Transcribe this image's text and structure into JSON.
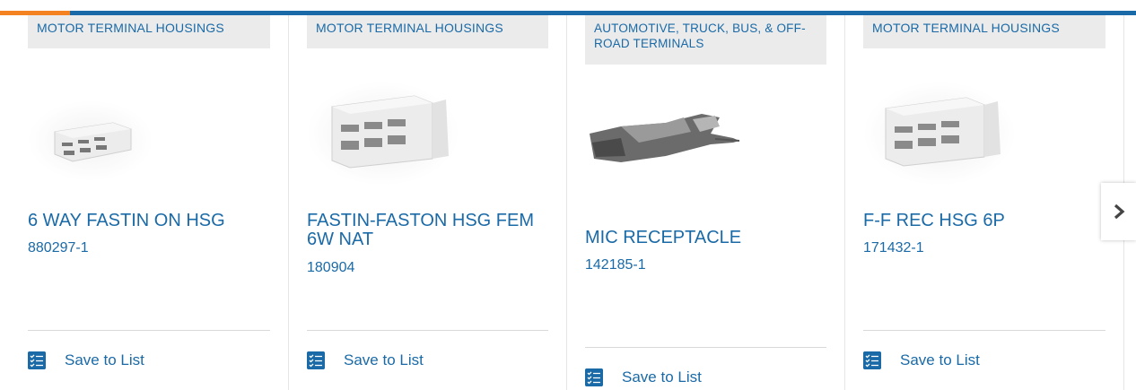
{
  "colors": {
    "brand_blue": "#1a6aa7",
    "accent_orange": "#f58220",
    "category_bg": "#ebebeb"
  },
  "carousel": {
    "next_icon": "chevron-right-icon",
    "cards": [
      {
        "category": "MOTOR TERMINAL HOUSINGS",
        "title": "6 WAY FASTIN ON HSG",
        "part_number": "880297-1",
        "image": "connector-housing-6way-image",
        "save_label": "Save to List"
      },
      {
        "category": "MOTOR TERMINAL HOUSINGS",
        "title": "FASTIN-FASTON HSG FEM 6W NAT",
        "part_number": "180904",
        "image": "connector-housing-fem-image",
        "save_label": "Save to List"
      },
      {
        "category": "AUTOMOTIVE, TRUCK, BUS, & OFF-ROAD TERMINALS",
        "title": "MIC RECEPTACLE",
        "part_number": "142185-1",
        "image": "metal-receptacle-terminal-image",
        "save_label": "Save to List"
      },
      {
        "category": "MOTOR TERMINAL HOUSINGS",
        "title": "F-F REC HSG 6P",
        "part_number": "171432-1",
        "image": "connector-housing-6p-image",
        "save_label": "Save to List"
      }
    ]
  }
}
